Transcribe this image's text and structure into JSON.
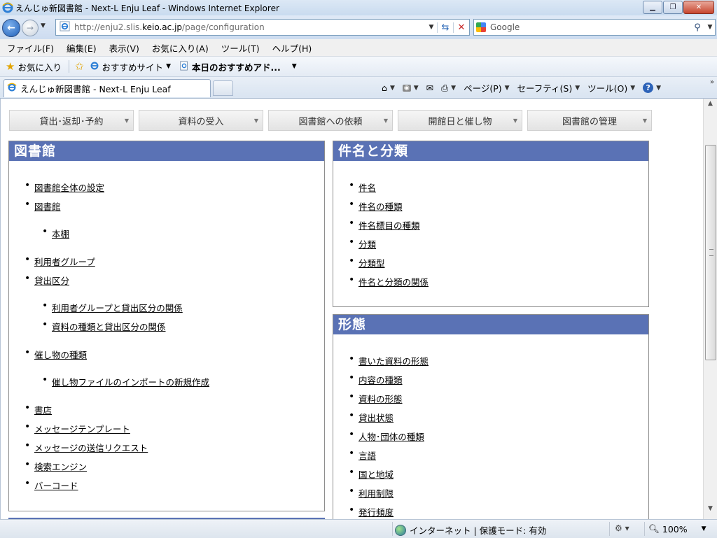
{
  "window": {
    "title": "えんじゅ新図書館 - Next-L Enju Leaf - Windows Internet Explorer",
    "minimize": "▁",
    "maximize": "❐",
    "close": "✕"
  },
  "address": {
    "url_prefix": "http://enju2.slis.",
    "url_domain": "keio.ac.jp",
    "url_suffix": "/page/configuration"
  },
  "search": {
    "label": "Google"
  },
  "menu": [
    "ファイル(F)",
    "編集(E)",
    "表示(V)",
    "お気に入り(A)",
    "ツール(T)",
    "ヘルプ(H)"
  ],
  "favorites": {
    "main": "お気に入り",
    "suggested": "おすすめサイト",
    "addon": "本日のおすすめアド..."
  },
  "tab": {
    "title": "えんじゅ新図書館 - Next-L Enju Leaf"
  },
  "commands": {
    "page": "ページ(P)",
    "safety": "セーフティ(S)",
    "tools": "ツール(O)"
  },
  "nav": [
    "貸出･返却･予約",
    "資料の受入",
    "図書館への依頼",
    "開館日と催し物",
    "図書館の管理"
  ],
  "panels": {
    "library": {
      "title": "図書館",
      "items": [
        {
          "label": "図書館全体の設定"
        },
        {
          "label": "図書館",
          "children": [
            {
              "label": "本棚"
            }
          ]
        },
        {
          "label": "利用者グループ"
        },
        {
          "label": "貸出区分",
          "children": [
            {
              "label": "利用者グループと貸出区分の関係"
            },
            {
              "label": "資料の種類と貸出区分の関係"
            }
          ]
        },
        {
          "label": "催し物の種類",
          "children": [
            {
              "label": "催し物ファイルのインポートの新規作成"
            }
          ]
        },
        {
          "label": "書店"
        },
        {
          "label": "メッセージテンプレート"
        },
        {
          "label": "メッセージの送信リクエスト"
        },
        {
          "label": "検索エンジン"
        },
        {
          "label": "バーコード"
        }
      ]
    },
    "subjects": {
      "title": "件名と分類",
      "items": [
        "件名",
        "件名の種類",
        "件名標目の種類",
        "分類",
        "分類型",
        "件名と分類の関係"
      ]
    },
    "forms": {
      "title": "形態",
      "items": [
        "書いた資料の形態",
        "内容の種類",
        "資料の形態",
        "貸出状態",
        "人物･団体の種類",
        "言語",
        "国と地域",
        "利用制限",
        "発行頻度"
      ]
    }
  },
  "status": {
    "zone": "インターネット | 保護モード: 有効",
    "zoom": "100%"
  }
}
